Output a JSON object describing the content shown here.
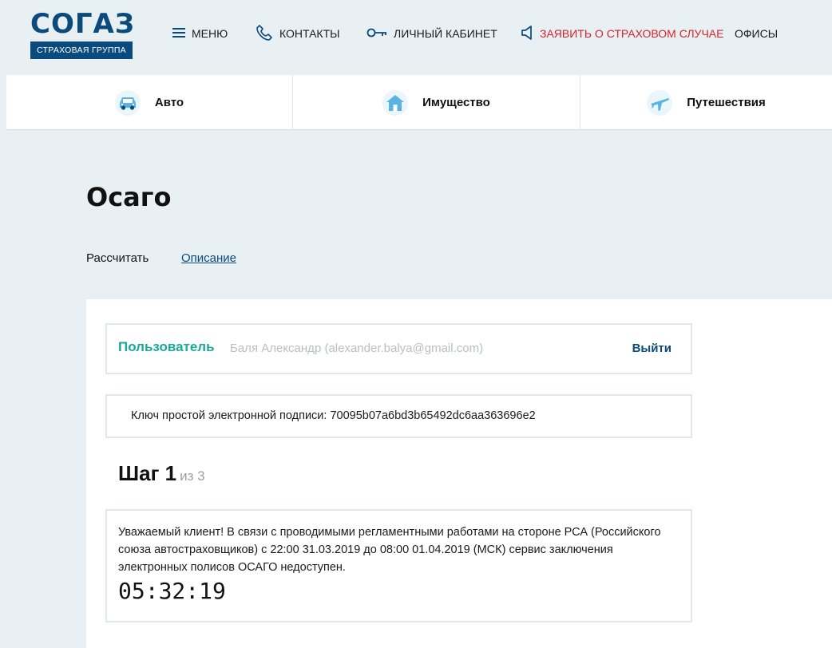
{
  "logo": {
    "name": "СОГАЗ",
    "subtitle": "СТРАХОВАЯ ГРУППА",
    "brand_color": "#0b4a7d"
  },
  "topnav": {
    "menu": {
      "label": "МЕНЮ",
      "icon": "hamburger-icon"
    },
    "contacts": {
      "label": "КОНТАКТЫ",
      "icon": "phone-icon"
    },
    "account": {
      "label": "ЛИЧНЫЙ КАБИНЕТ",
      "icon": "key-icon"
    },
    "claim": {
      "label": "ЗАЯВИТЬ О СТРАХОВОМ СЛУЧАЕ",
      "icon": "megaphone-icon",
      "color": "#d8232a"
    },
    "offices": {
      "label": "ОФИСЫ"
    }
  },
  "categories": [
    {
      "label": "Авто",
      "icon": "car-icon"
    },
    {
      "label": "Имущество",
      "icon": "house-icon"
    },
    {
      "label": "Путешествия",
      "icon": "airplane-icon"
    }
  ],
  "page": {
    "title": "Осаго",
    "tabs": [
      {
        "label": "Рассчитать",
        "active": true
      },
      {
        "label": "Описание",
        "active": false
      }
    ]
  },
  "user": {
    "label": "Пользователь",
    "name": "Баля Александр (alexander.balya@gmail.com)",
    "logout": "Выйти",
    "accent": "#19a99a"
  },
  "signature": {
    "text": "Ключ простой электронной подписи: 70095b07a6bd3b65492dc6aa363696e2"
  },
  "step": {
    "current": "Шаг 1",
    "total": "из 3"
  },
  "notice": {
    "text": "Уважаемый клиент! В связи с проводимыми регламентными работами на стороне РСА (Российского союза автостраховщиков) с 22:00 31.03.2019 до 08:00 01.04.2019 (МСК) сервис заключения электронных полисов ОСАГО недоступен.",
    "timer": "05:32:19"
  }
}
